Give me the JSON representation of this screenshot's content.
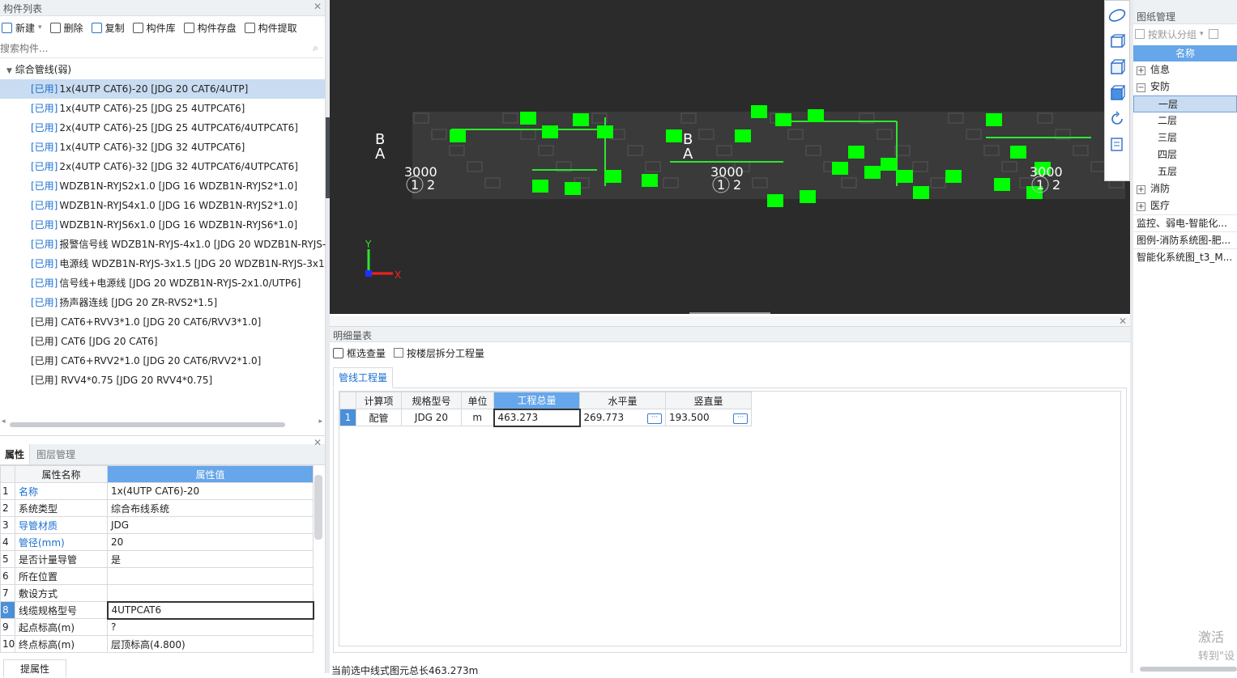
{
  "left_panel": {
    "title": "构件列表",
    "toolbar": {
      "new": "新建",
      "delete": "删除",
      "copy": "复制",
      "library": "构件库",
      "save": "构件存盘",
      "extract": "构件提取"
    },
    "search_placeholder": "搜索构件...",
    "root": "综合管线(弱)",
    "items": [
      {
        "tag": "[已用]",
        "label": "1x(4UTP CAT6)-20 [JDG 20 CAT6/4UTP]"
      },
      {
        "tag": "[已用]",
        "label": "1x(4UTP CAT6)-25 [JDG 25 4UTPCAT6]"
      },
      {
        "tag": "[已用]",
        "label": "2x(4UTP CAT6)-25 [JDG 25 4UTPCAT6/4UTPCAT6]"
      },
      {
        "tag": "[已用]",
        "label": "1x(4UTP CAT6)-32 [JDG 32 4UTPCAT6]"
      },
      {
        "tag": "[已用]",
        "label": "2x(4UTP CAT6)-32 [JDG 32 4UTPCAT6/4UTPCAT6]"
      },
      {
        "tag": "[已用]",
        "label": "WDZB1N-RYJS2x1.0 [JDG 16 WDZB1N-RYJS2*1.0]"
      },
      {
        "tag": "[已用]",
        "label": "WDZB1N-RYJS4x1.0 [JDG 16 WDZB1N-RYJS2*1.0]"
      },
      {
        "tag": "[已用]",
        "label": "WDZB1N-RYJS6x1.0 [JDG 16 WDZB1N-RYJS6*1.0]"
      },
      {
        "tag": "[已用]",
        "label": "报警信号线 WDZB1N-RYJS-4x1.0 [JDG 20 WDZB1N-RYJS-"
      },
      {
        "tag": "[已用]",
        "label": "电源线 WDZB1N-RYJS-3x1.5 [JDG 20 WDZB1N-RYJS-3x1."
      },
      {
        "tag": "[已用]",
        "label": "信号线+电源线 [JDG 20 WDZB1N-RYJS-2x1.0/UTP6]"
      },
      {
        "tag": "[已用]",
        "label": "扬声器连线 [JDG 20 ZR-RVS2*1.5]"
      }
    ],
    "items_plain": [
      "[已用] CAT6+RVV3*1.0 [JDG 20 CAT6/RVV3*1.0]",
      "[已用] CAT6 [JDG 20 CAT6]",
      "[已用] CAT6+RVV2*1.0 [JDG 20 CAT6/RVV2*1.0]",
      "[已用] RVV4*0.75 [JDG 20 RVV4*0.75]"
    ]
  },
  "props": {
    "tab_props": "属性",
    "tab_layers": "图层管理",
    "col_name": "属性名称",
    "col_value": "属性值",
    "rows": [
      {
        "n": "1",
        "name": "名称",
        "value": "1x(4UTP CAT6)-20",
        "blue": true
      },
      {
        "n": "2",
        "name": "系统类型",
        "value": "综合布线系统",
        "blue": false
      },
      {
        "n": "3",
        "name": "导管材质",
        "value": "JDG",
        "blue": true
      },
      {
        "n": "4",
        "name": "管径(mm)",
        "value": "20",
        "blue": true
      },
      {
        "n": "5",
        "name": "是否计量导管",
        "value": "是",
        "blue": false
      },
      {
        "n": "6",
        "name": "所在位置",
        "value": "",
        "blue": false
      },
      {
        "n": "7",
        "name": "敷设方式",
        "value": "",
        "blue": false
      },
      {
        "n": "8",
        "name": "线缆规格型号",
        "value": "4UTPCAT6",
        "blue": false
      },
      {
        "n": "9",
        "name": "起点标高(m)",
        "value": "?",
        "blue": false
      },
      {
        "n": "10",
        "name": "终点标高(m)",
        "value": "层顶标高(4.800)",
        "blue": false
      }
    ],
    "bottom_tab": "提属性"
  },
  "viewport": {
    "labels": {
      "b": "B",
      "a": "A",
      "dim": "3000",
      "one": "1",
      "two": "2",
      "y": "Y",
      "x": "X"
    }
  },
  "detail": {
    "title": "明细量表",
    "frame_select": "框选查量",
    "split_by_floor": "按楼层拆分工程量",
    "tab": "管线工程量",
    "headers": [
      "计算项",
      "规格型号",
      "单位",
      "工程总量",
      "水平量",
      "竖直量"
    ],
    "row": {
      "n": "1",
      "item": "配管",
      "spec": "JDG 20",
      "unit": "m",
      "total": "463.273",
      "horiz": "269.773",
      "vert": "193.500"
    },
    "status": "当前选中线式图元总长463.273m"
  },
  "right_panel": {
    "title": "图纸管理",
    "group_by": "按默认分组",
    "col": "名称",
    "tree": [
      {
        "label": "信息",
        "level": 0,
        "exp": "+"
      },
      {
        "label": "安防",
        "level": 0,
        "exp": "-"
      },
      {
        "label": "一层",
        "level": 1,
        "sel": true
      },
      {
        "label": "二层",
        "level": 1
      },
      {
        "label": "三层",
        "level": 1
      },
      {
        "label": "四层",
        "level": 1
      },
      {
        "label": "五层",
        "level": 1
      },
      {
        "label": "消防",
        "level": 0,
        "exp": "+"
      },
      {
        "label": "医疗",
        "level": 0,
        "exp": "+"
      }
    ],
    "files": [
      "监控、弱电-智能化...",
      "图例-消防系统图-肥...",
      "智能化系统图_t3_M..."
    ]
  },
  "watermark": {
    "line1": "激活",
    "line2": "转到\"设"
  }
}
